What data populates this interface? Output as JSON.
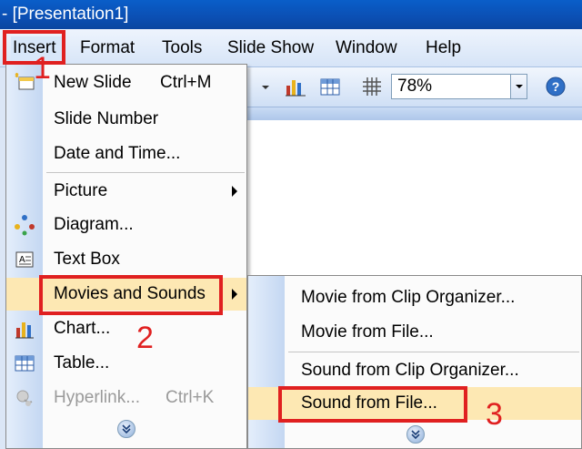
{
  "window": {
    "title": "- [Presentation1]"
  },
  "menubar": {
    "items": [
      {
        "label": "Insert",
        "key": "I"
      },
      {
        "label": "Format",
        "key": "o"
      },
      {
        "label": "Tools",
        "key": "T"
      },
      {
        "label": "Slide Show",
        "key": "d"
      },
      {
        "label": "Window",
        "key": "W"
      },
      {
        "label": "Help",
        "key": "H"
      }
    ]
  },
  "toolbar": {
    "zoom_value": "78%"
  },
  "insert_menu": {
    "items": [
      {
        "label": "New Slide",
        "shortcut": "Ctrl+M",
        "icon": "new-slide-icon"
      },
      {
        "label": "Slide Number"
      },
      {
        "label": "Date and Time..."
      },
      {
        "label": "Picture",
        "submenu": true
      },
      {
        "label": "Diagram...",
        "icon": "diagram-icon"
      },
      {
        "label": "Text Box",
        "icon": "text-box-icon"
      },
      {
        "label": "Movies and Sounds",
        "submenu": true
      },
      {
        "label": "Chart...",
        "icon": "chart-icon"
      },
      {
        "label": "Table...",
        "icon": "table-icon"
      },
      {
        "label": "Hyperlink...",
        "shortcut": "Ctrl+K",
        "icon": "hyperlink-icon",
        "disabled": true
      }
    ]
  },
  "movies_menu": {
    "items": [
      {
        "label": "Movie from Clip Organizer..."
      },
      {
        "label": "Movie from File..."
      },
      {
        "label": "Sound from Clip Organizer..."
      },
      {
        "label": "Sound from File..."
      }
    ]
  },
  "annotations": {
    "step1": "1",
    "step2": "2",
    "step3": "3",
    "color": "#e02020"
  }
}
